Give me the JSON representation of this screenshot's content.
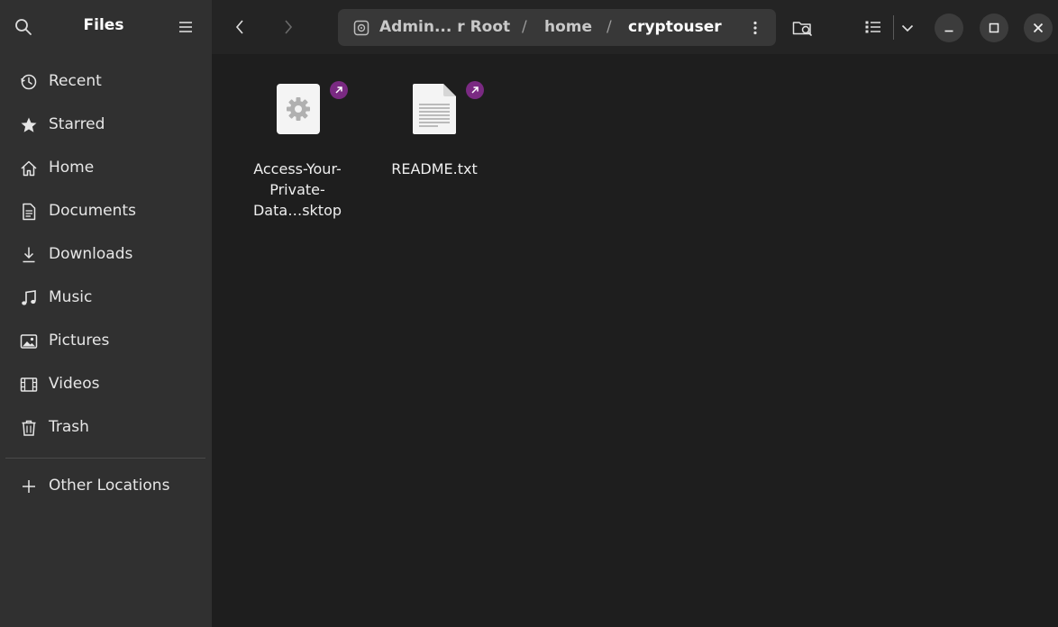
{
  "sidebar": {
    "title": "Files",
    "items": [
      {
        "label": "Recent",
        "icon": "clock-icon"
      },
      {
        "label": "Starred",
        "icon": "star-icon"
      },
      {
        "label": "Home",
        "icon": "home-icon"
      },
      {
        "label": "Documents",
        "icon": "document-icon"
      },
      {
        "label": "Downloads",
        "icon": "download-icon"
      },
      {
        "label": "Music",
        "icon": "music-icon"
      },
      {
        "label": "Pictures",
        "icon": "picture-icon"
      },
      {
        "label": "Videos",
        "icon": "film-icon"
      },
      {
        "label": "Trash",
        "icon": "trash-icon"
      }
    ],
    "other_locations": "Other Locations"
  },
  "path": {
    "root": "Admin... r Root",
    "separator": "/",
    "home": "home",
    "current": "cryptouser"
  },
  "files": [
    {
      "name_lines": [
        "Access-Your-",
        "Private-",
        "Data…sktop"
      ],
      "type": "desktop-entry",
      "emblem": "symlink-arrow-icon"
    },
    {
      "name_lines": [
        "README.txt"
      ],
      "type": "text-file",
      "emblem": "symlink-arrow-icon"
    }
  ],
  "colors": {
    "sidebar_bg": "#303030",
    "content_bg": "#1e1e1e",
    "emblem": "#7a2a82"
  }
}
